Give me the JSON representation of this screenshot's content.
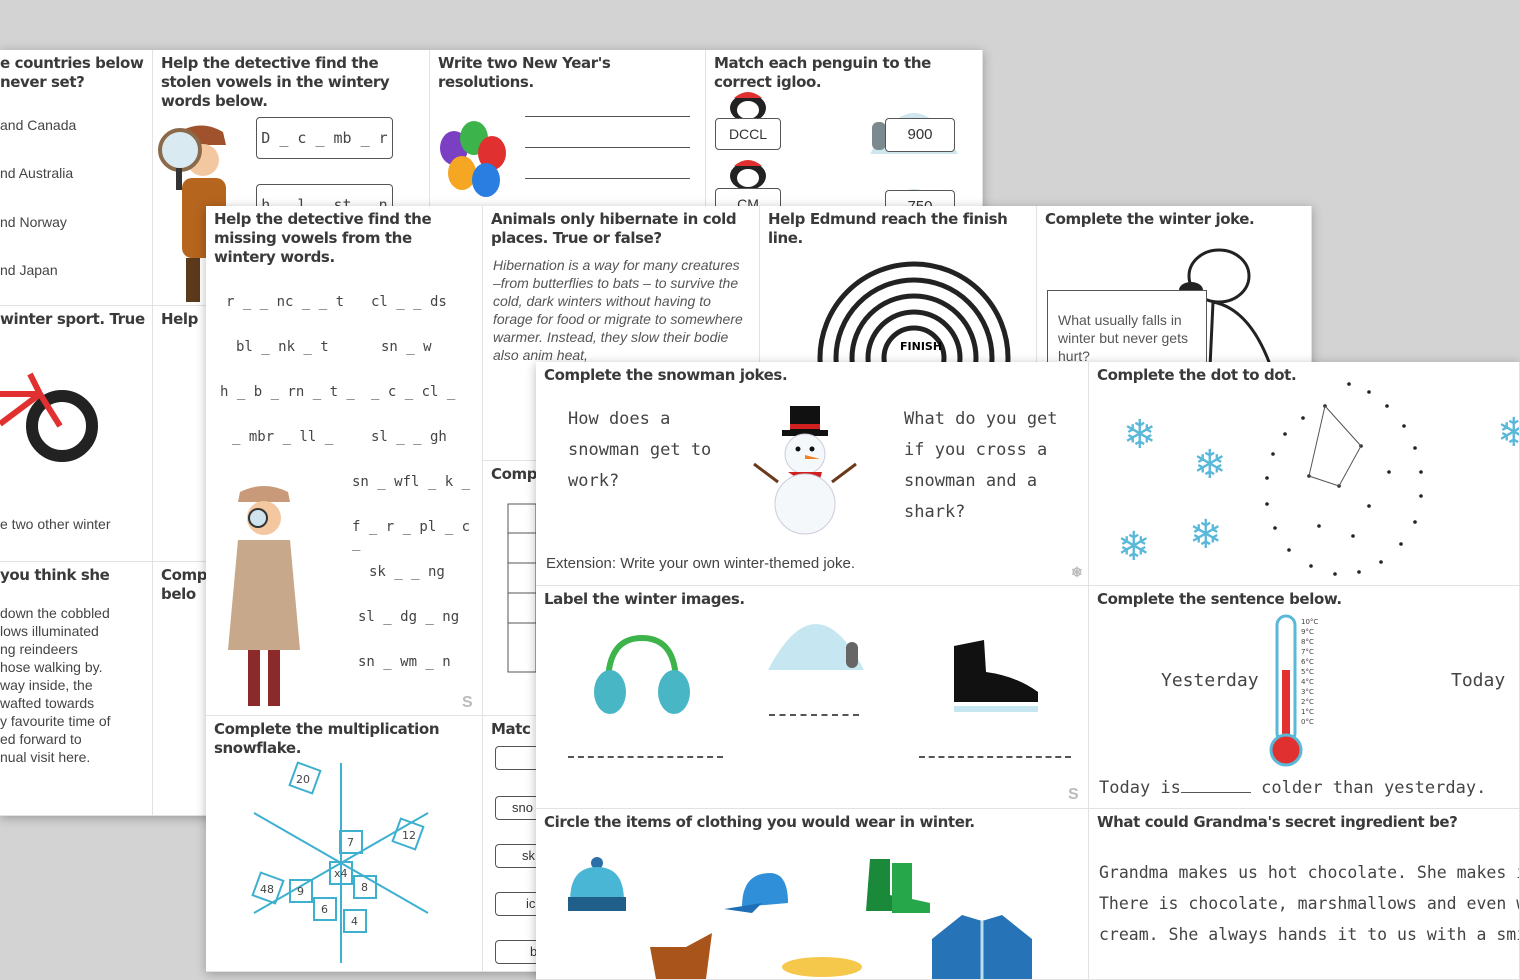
{
  "back": {
    "q_countries": "e countries below\nnever set?",
    "countries": [
      "and Canada",
      "nd Australia",
      "nd Norway",
      "nd Japan"
    ],
    "q_vowels": "Help the detective find the stolen vowels in the wintery words below.",
    "vowel_words": [
      "D _ c _ mb _ r",
      "h _ l _ st _ n _ s"
    ],
    "q_resolutions": "Write two New Year's resolutions.",
    "q_penguin": "Match each penguin to the correct igloo.",
    "penguin_left": [
      "DCCL",
      "CM"
    ],
    "igloo_right": [
      "900",
      "750"
    ],
    "q_sport": "winter sport.  True",
    "q_help": "Help",
    "q_two_other": "e two other winter",
    "q_think": "you think she",
    "story": [
      "down the cobbled",
      "lows illuminated",
      "ng reindeers",
      "hose walking by.",
      "way inside, the",
      "wafted towards",
      "y favourite time of",
      "ed forward to",
      "nual visit here."
    ],
    "q_comp": "Comp\nbelo"
  },
  "middle": {
    "q_vowels": "Help the detective find the missing vowels from the wintery words.",
    "words_left": [
      "r _ _ nc _ _ t",
      "bl _ nk _ t",
      "h _ b _ rn _ t _",
      "_ mbr _ ll _"
    ],
    "words_right": [
      "cl _ _ ds",
      "sn _ w",
      "_ c _ cl _",
      "sl _ _ gh",
      "sn _ wfl _ k _",
      "f _ r _ pl _ c _",
      "sk _ _ ng",
      "sl _ dg _ ng",
      "sn _ wm _ n"
    ],
    "q_hibernate": "Animals only hibernate in cold places. True or false?",
    "hibernate_text": "Hibernation is a way for many creatures –from butterflies to bats – to survive the cold, dark winters without having to forage for food or migrate to somewhere warmer. Instead, they slow their bodie also anim heat,",
    "q_maze": "Help Edmund reach the finish line.",
    "maze_finish": "FINISH",
    "q_joke": "Complete the winter joke.",
    "joke_text": "What usually falls in winter but never gets hurt?",
    "q_mult": "Complete the multiplication snowflake.",
    "snowflake_center": "x4",
    "snowflake_inner": [
      "7",
      "8",
      "4",
      "6",
      "9"
    ],
    "snowflake_outer": [
      "20",
      "12",
      "48"
    ],
    "q_comp2": "Comp",
    "q_match": "Matc",
    "match_boxes": [
      "",
      "sno",
      "sk",
      "ic",
      "b"
    ]
  },
  "front": {
    "q_snowman": "Complete the snowman jokes.",
    "joke1": [
      "How does a",
      "snowman get to",
      "work?"
    ],
    "joke2": [
      "What do you get",
      "if you cross a",
      "snowman and a",
      "shark?"
    ],
    "extension": "Extension: Write your own winter-themed joke.",
    "q_dot": "Complete the dot to dot.",
    "q_label": "Label the winter images.",
    "q_sentence": "Complete the sentence below.",
    "yesterday": "Yesterday",
    "today": "Today",
    "therm_labels": [
      "10°C",
      "9°C",
      "8°C",
      "7°C",
      "6°C",
      "5°C",
      "4°C",
      "3°C",
      "2°C",
      "1°C",
      "0°C"
    ],
    "sentence_a": "Today is",
    "sentence_b": "colder than yesterday.",
    "q_clothing": "Circle the items of clothing you would wear in winter.",
    "q_grandma": "What could Grandma's secret ingredient be?",
    "grandma_lines": [
      "Grandma makes us hot chocolate. She makes it",
      "There is chocolate, marshmallows and even wh",
      "cream. She always hands it to us with a smile."
    ],
    "logo_s": "S"
  },
  "colors": {
    "background": "#d3d3d3",
    "ice": "#5ab8d8",
    "red": "#e03030"
  }
}
